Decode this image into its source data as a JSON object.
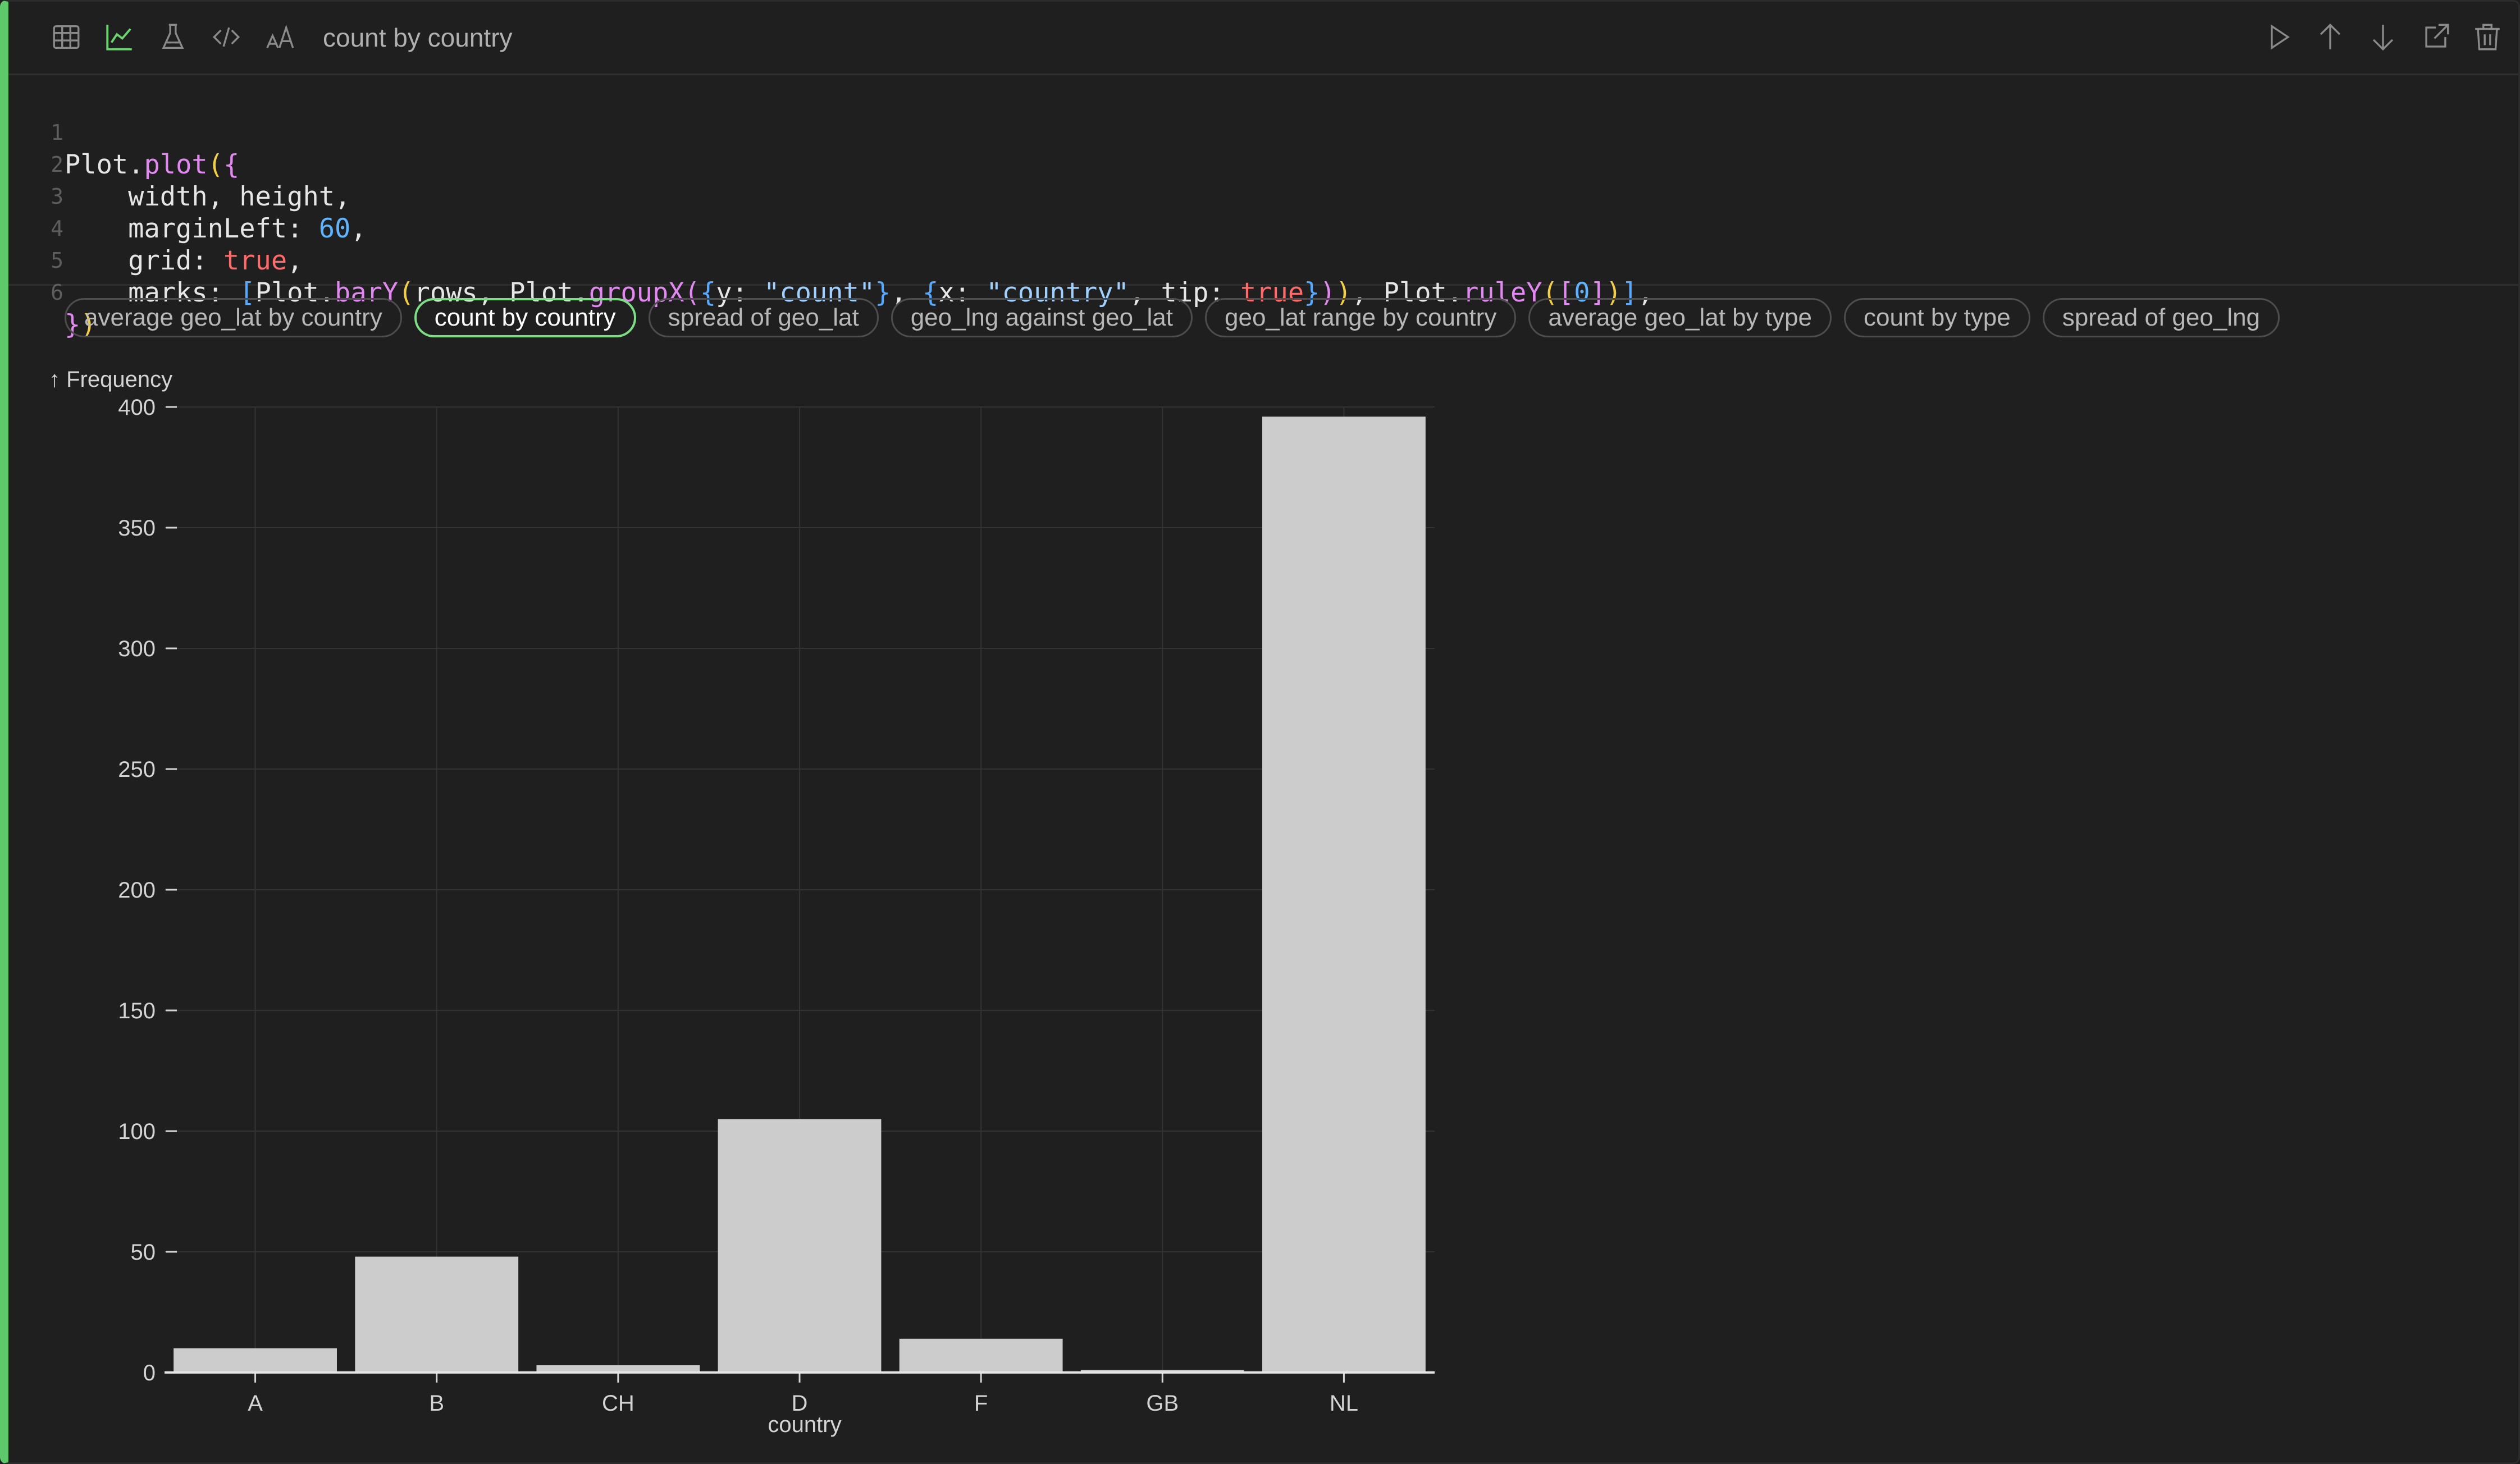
{
  "toolbar": {
    "left_icons": [
      "table-icon",
      "chart-icon",
      "flask-icon",
      "code-icon",
      "text-size-icon"
    ],
    "title": "count by country",
    "right_icons": [
      "play-icon",
      "arrow-up-icon",
      "arrow-down-icon",
      "share-icon",
      "trash-icon"
    ]
  },
  "code": {
    "line_numbers": [
      "1",
      "2",
      "3",
      "4",
      "5",
      "6"
    ],
    "l1": {
      "a": "Plot.",
      "b": "plot",
      "c": "(",
      "d": "{"
    },
    "l2": {
      "a": "    width, height,"
    },
    "l3": {
      "a": "    marginLeft: ",
      "b": "60",
      "c": ","
    },
    "l4": {
      "a": "    grid: ",
      "b": "true",
      "c": ","
    },
    "l5": {
      "a": "    marks: ",
      "b": "[",
      "c": "Plot.",
      "d": "barY",
      "e": "(",
      "f": "rows, Plot.",
      "g": "groupX",
      "h": "(",
      "i": "{",
      "j": "y: ",
      "k": "\"count\"",
      "l": "}",
      "m": ", ",
      "n": "{",
      "o": "x: ",
      "p": "\"country\"",
      "q": ", tip: ",
      "r": "true",
      "s": "}",
      "t": ")",
      "u": ")",
      "v": ", Plot.",
      "w": "ruleY",
      "x": "(",
      "y": "[",
      "z": "0",
      "aa": "]",
      "ab": ")",
      "ac": "]",
      "ad": ","
    },
    "l6": {
      "a": "}",
      "b": ")"
    }
  },
  "chips": [
    "average geo_lat by country",
    "count by country",
    "spread of geo_lat",
    "geo_lng against geo_lat",
    "geo_lat range by country",
    "average geo_lat by type",
    "count by type",
    "spread of geo_lng"
  ],
  "active_chip": "count by country",
  "colors": {
    "accent": "#5ec96a",
    "bar": "#cccccc",
    "grid": "#333333",
    "background": "#1f1f1f"
  },
  "chart_data": {
    "type": "bar",
    "categories": [
      "A",
      "B",
      "CH",
      "D",
      "F",
      "GB",
      "NL"
    ],
    "values": [
      10,
      48,
      3,
      105,
      14,
      1,
      396
    ],
    "title": "",
    "xlabel": "country",
    "ylabel": "↑ Frequency",
    "ylim": [
      0,
      400
    ],
    "yticks": [
      0,
      50,
      100,
      150,
      200,
      250,
      300,
      350,
      400
    ],
    "grid": true
  }
}
